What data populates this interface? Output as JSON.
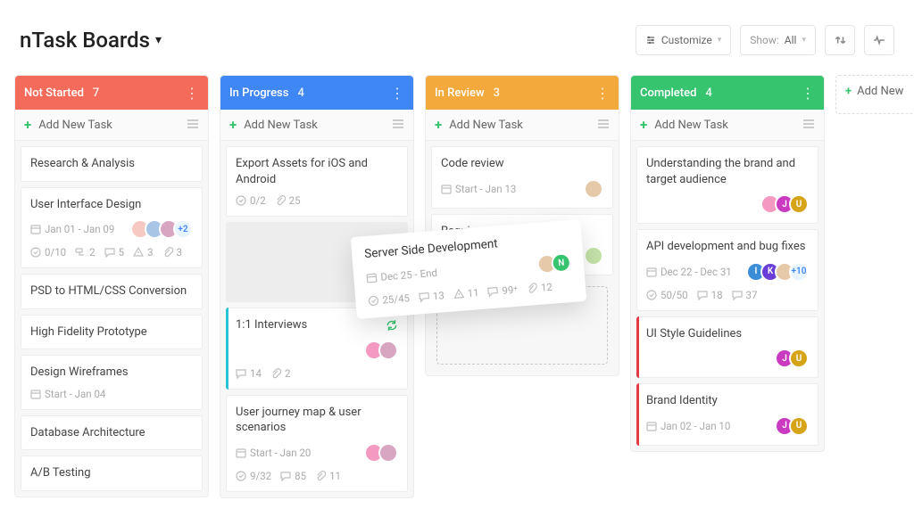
{
  "header": {
    "title": "nTask Boards"
  },
  "toolbar": {
    "customize": "Customize",
    "show_prefix": "Show:",
    "show_value": "All",
    "add_column": "Add New"
  },
  "add_task_label": "Add New Task",
  "columns": [
    {
      "name": "Not Started",
      "count": "7",
      "color": "c-red"
    },
    {
      "name": "In Progress",
      "count": "4",
      "color": "c-blue"
    },
    {
      "name": "In Review",
      "count": "3",
      "color": "c-orange"
    },
    {
      "name": "Completed",
      "count": "4",
      "color": "c-green"
    }
  ],
  "not_started": {
    "card1": {
      "title": "Research & Analysis"
    },
    "card2": {
      "title": "User Interface Design",
      "date": "Jan 01 - Jan 09",
      "check": "0/10",
      "sub": "2",
      "comments": "5",
      "alerts": "3",
      "attach": "3",
      "extra": "+2"
    },
    "card3": {
      "title": "PSD to HTML/CSS Conversion"
    },
    "card4": {
      "title": "High Fidelity Prototype"
    },
    "card5": {
      "title": "Design Wireframes",
      "date": "Start - Jan 04"
    },
    "card6": {
      "title": "Database Architecture"
    },
    "card7": {
      "title": "A/B Testing"
    }
  },
  "in_progress": {
    "card1": {
      "title": "Export Assets for iOS and Android",
      "check": "0/2",
      "attach": "25"
    },
    "card2": {
      "title": "1:1 Interviews",
      "comments": "14",
      "attach": "2"
    },
    "card3": {
      "title": "User journey map & user scenarios",
      "date": "Start - Jan 20",
      "check": "9/32",
      "comments": "85",
      "attach": "11"
    }
  },
  "in_review": {
    "card1": {
      "title": "Code review",
      "date": "Start - Jan 13"
    },
    "card2": {
      "title": "Requirement Document"
    }
  },
  "completed": {
    "card1": {
      "title": "Understanding the brand and target audience"
    },
    "card2": {
      "title": "API development and bug fixes",
      "date": "Dec 22 - Dec 31",
      "check": "50/50",
      "comments1": "18",
      "comments2": "37",
      "extra": "+10"
    },
    "card3": {
      "title": "UI Style Guidelines"
    },
    "card4": {
      "title": "Brand Identity",
      "date": "Jan 02 - Jan 10"
    }
  },
  "drag": {
    "title": "Server Side Development",
    "date": "Dec 25 - End",
    "check": "25/45",
    "comments": "13",
    "alerts": "11",
    "msg": "99⁺",
    "attach": "12"
  },
  "avatar_colors": {
    "a1": "#f7c9c3",
    "a2": "#a8c5e6",
    "a3": "#d9a6c1",
    "a4": "#f49ac1",
    "j": "#c93ac0",
    "u": "#d6a419",
    "k": "#6a3dd6",
    "i": "#3a8dd6",
    "n": "#36c46f"
  }
}
